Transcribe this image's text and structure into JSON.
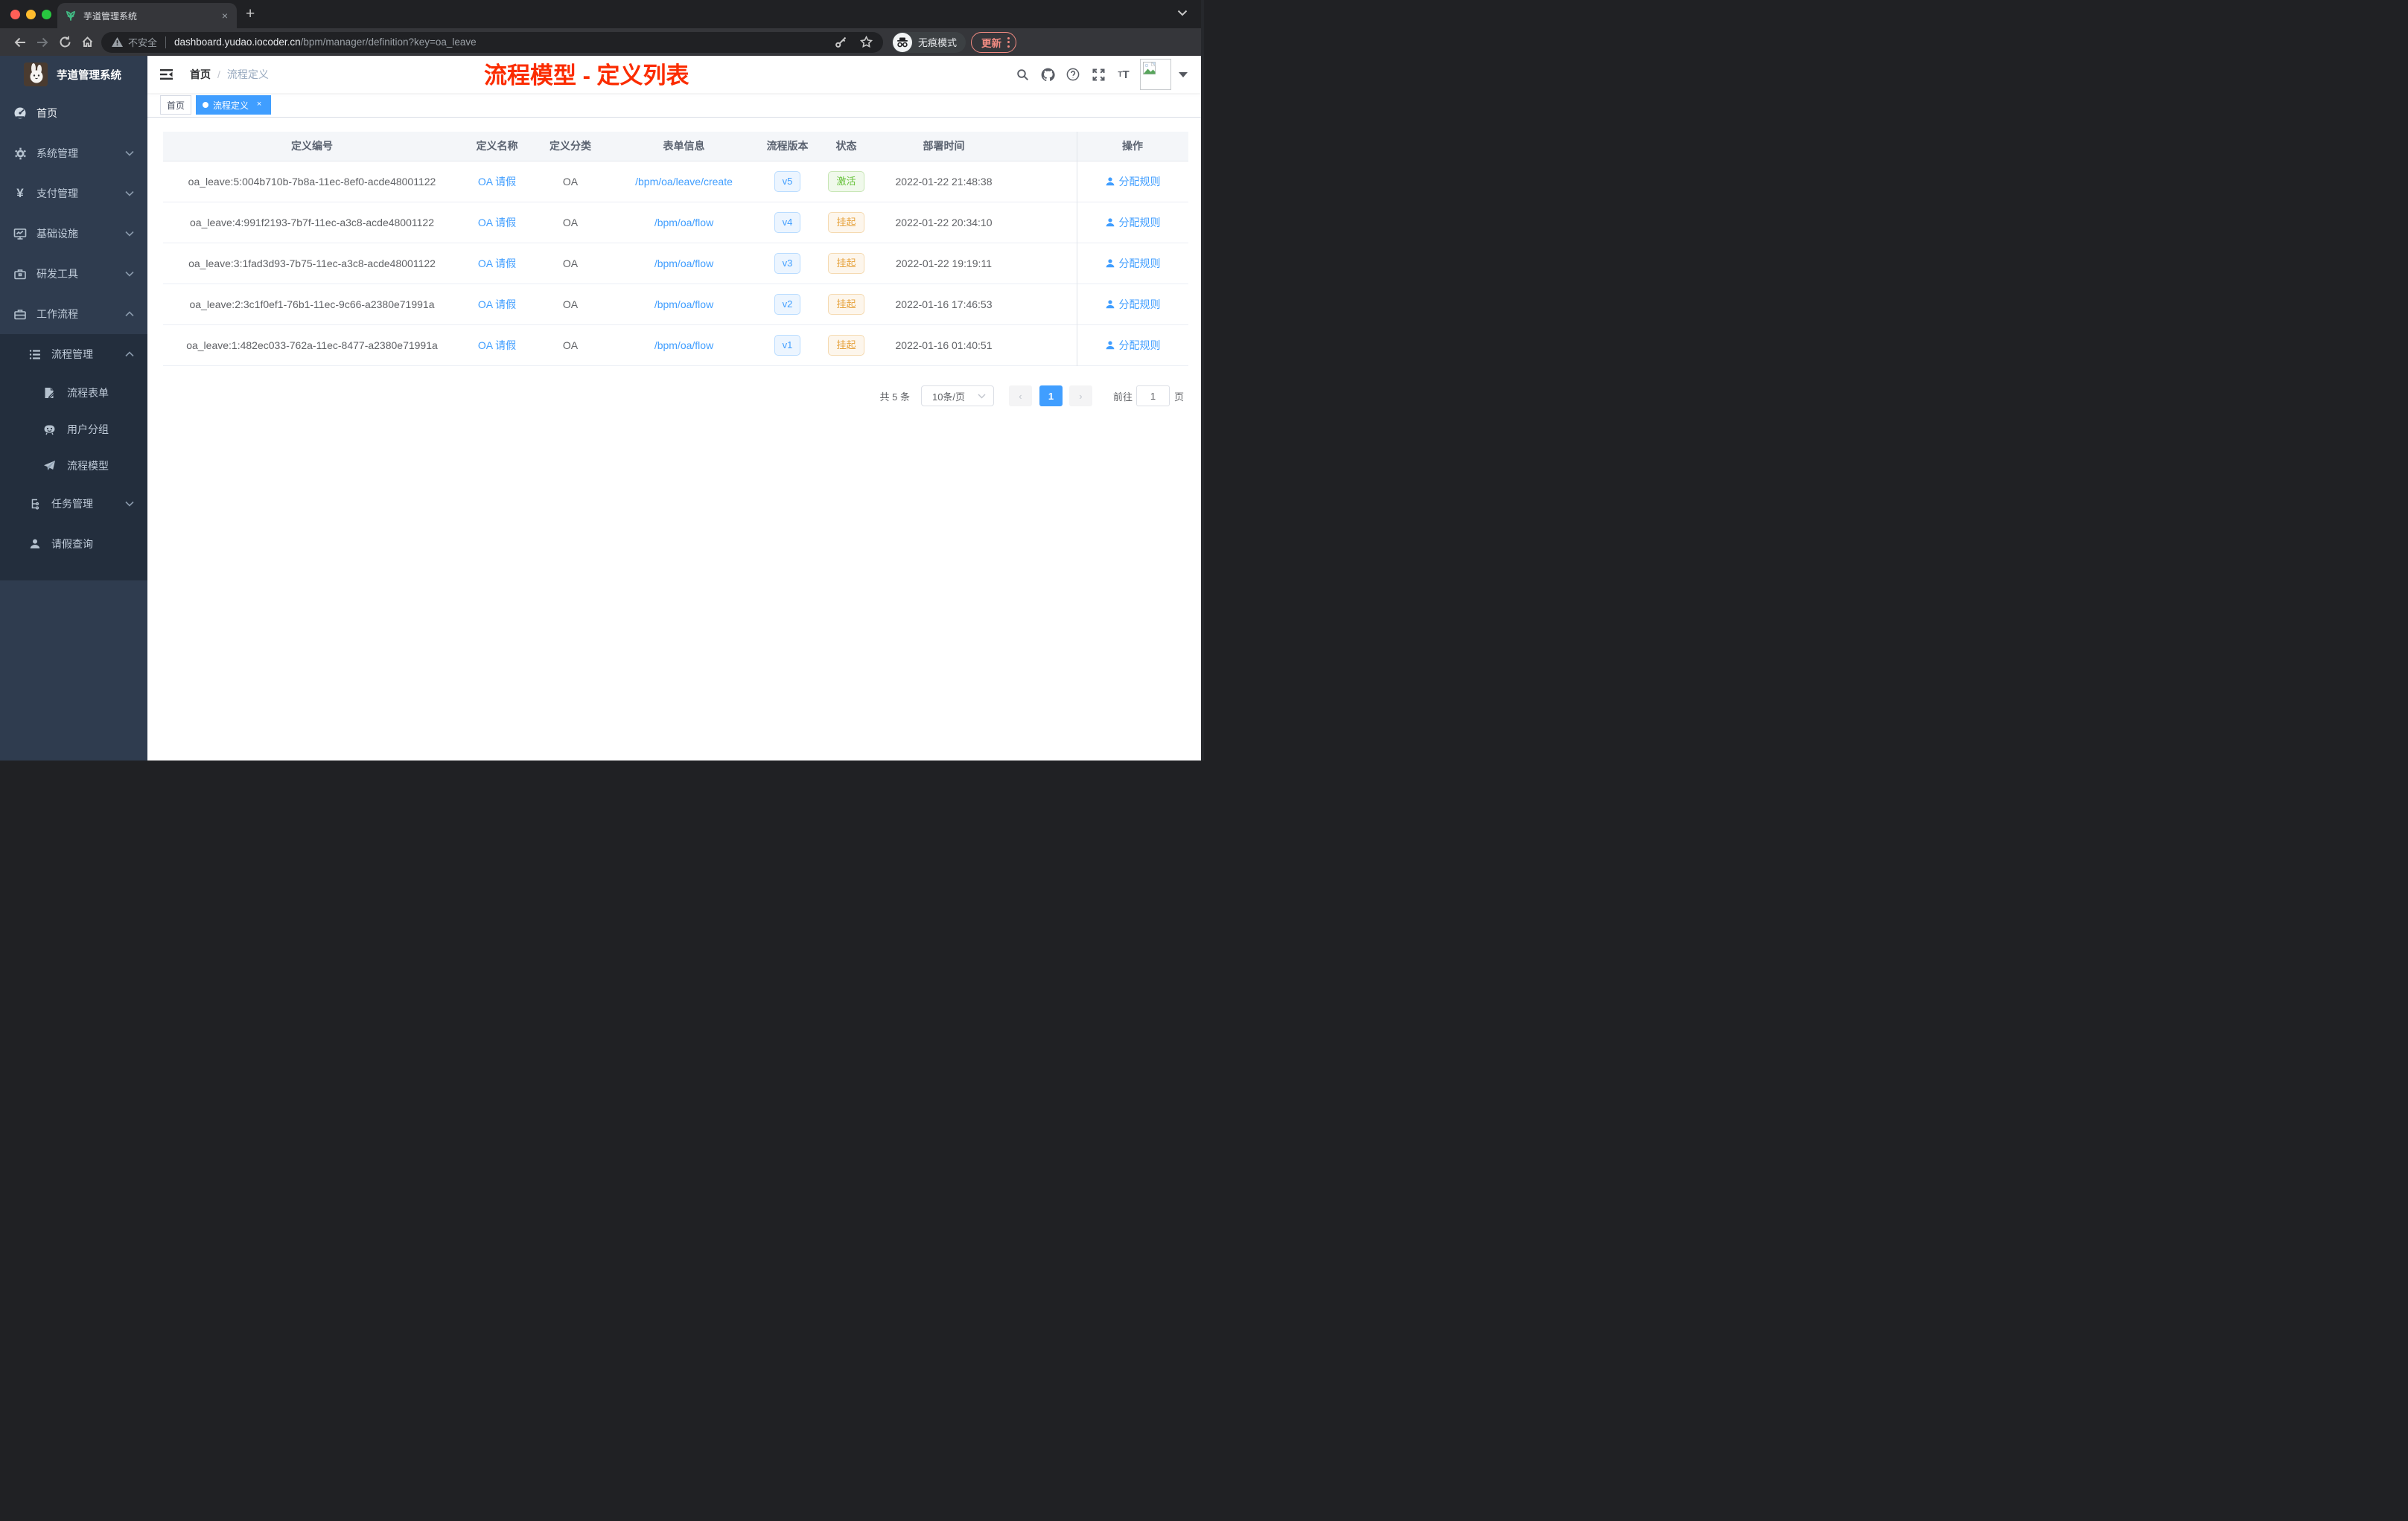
{
  "browser": {
    "tab": {
      "title": "芋道管理系统",
      "favicon": "plant-icon",
      "close": "×",
      "new_tab": "+"
    },
    "url": {
      "security_label": "不安全",
      "host": "dashboard.yudao.iocoder.cn",
      "path": "/bpm/manager/definition?key=oa_leave"
    },
    "toolbar_icons": [
      "back",
      "forward",
      "reload",
      "home",
      "key",
      "star"
    ],
    "incognito_label": "无痕模式",
    "update_label": "更新"
  },
  "sidebar": {
    "logo_title": "芋道管理系统",
    "items": [
      {
        "label": "首页",
        "icon": "dashboard-icon"
      },
      {
        "label": "系统管理",
        "icon": "gear-icon",
        "chevron": "down"
      },
      {
        "label": "支付管理",
        "icon": "yen-icon",
        "chevron": "down"
      },
      {
        "label": "基础设施",
        "icon": "monitor-icon",
        "chevron": "down"
      },
      {
        "label": "研发工具",
        "icon": "toolbox-icon",
        "chevron": "down"
      },
      {
        "label": "工作流程",
        "icon": "briefcase-icon",
        "chevron": "up"
      },
      {
        "label": "流程管理",
        "icon": "list-icon",
        "chevron": "up"
      },
      {
        "label": "流程表单",
        "icon": "form-icon"
      },
      {
        "label": "用户分组",
        "icon": "group-icon"
      },
      {
        "label": "流程模型",
        "icon": "paper-plane-icon"
      },
      {
        "label": "任务管理",
        "icon": "tree-icon",
        "chevron": "down"
      },
      {
        "label": "请假查询",
        "icon": "user-icon"
      }
    ]
  },
  "navbar": {
    "breadcrumb": {
      "home": "首页",
      "separator": "/",
      "current": "流程定义"
    },
    "icons": [
      "search",
      "github",
      "help",
      "fullscreen",
      "font-size",
      "avatar",
      "caret-down"
    ]
  },
  "annotation": {
    "text": "流程模型 - 定义列表",
    "color": "#fb2c00"
  },
  "tags": {
    "home": {
      "label": "首页",
      "active": false
    },
    "current": {
      "label": "流程定义",
      "active": true,
      "close": "×"
    }
  },
  "table": {
    "headers": [
      "定义编号",
      "定义名称",
      "定义分类",
      "表单信息",
      "流程版本",
      "状态",
      "部署时间",
      "操作"
    ],
    "rows": [
      {
        "id": "oa_leave:5:004b710b-7b8a-11ec-8ef0-acde48001122",
        "name": "OA 请假",
        "category": "OA",
        "form": "/bpm/oa/leave/create",
        "version": "v5",
        "status": "激活",
        "status_type": "success",
        "deployed_at": "2022-01-22 21:48:38",
        "action": "分配规则"
      },
      {
        "id": "oa_leave:4:991f2193-7b7f-11ec-a3c8-acde48001122",
        "name": "OA 请假",
        "category": "OA",
        "form": "/bpm/oa/flow",
        "version": "v4",
        "status": "挂起",
        "status_type": "warning",
        "deployed_at": "2022-01-22 20:34:10",
        "action": "分配规则"
      },
      {
        "id": "oa_leave:3:1fad3d93-7b75-11ec-a3c8-acde48001122",
        "name": "OA 请假",
        "category": "OA",
        "form": "/bpm/oa/flow",
        "version": "v3",
        "status": "挂起",
        "status_type": "warning",
        "deployed_at": "2022-01-22 19:19:11",
        "action": "分配规则"
      },
      {
        "id": "oa_leave:2:3c1f0ef1-76b1-11ec-9c66-a2380e71991a",
        "name": "OA 请假",
        "category": "OA",
        "form": "/bpm/oa/flow",
        "version": "v2",
        "status": "挂起",
        "status_type": "warning",
        "deployed_at": "2022-01-16 17:46:53",
        "action": "分配规则"
      },
      {
        "id": "oa_leave:1:482ec033-762a-11ec-8477-a2380e71991a",
        "name": "OA 请假",
        "category": "OA",
        "form": "/bpm/oa/flow",
        "version": "v1",
        "status": "挂起",
        "status_type": "warning",
        "deployed_at": "2022-01-16 01:40:51",
        "action": "分配规则"
      }
    ]
  },
  "pagination": {
    "total_label": "共 5 条",
    "page_size": "10条/页",
    "prev": "‹",
    "current_page": "1",
    "next": "›",
    "goto_label": "前往",
    "goto_value": "1",
    "page_label": "页"
  },
  "colors": {
    "accent_blue": "#409eff",
    "status_active_green": "#67c23a",
    "status_suspend_orange": "#e6a23c",
    "sidebar_bg": "#2f3c4f",
    "sidebar_sub_bg": "#232e3d",
    "annotation_red": "#fb2c00"
  }
}
